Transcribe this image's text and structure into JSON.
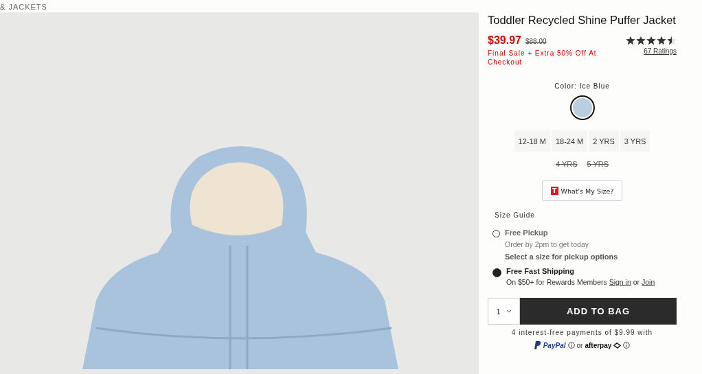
{
  "breadcrumb": "& JACKETS",
  "product": {
    "title": "Toddler Recycled Shine Puffer Jacket",
    "price": "$39.97",
    "original_price": "$88.00",
    "promo": "Final Sale + Extra 50% Off At Checkout",
    "stars": 4.5,
    "ratings": "67 Ratings"
  },
  "color": {
    "label": "Color: Ice Blue",
    "swatches": [
      {
        "color": "#b8cfdf",
        "selected": true
      }
    ]
  },
  "sizes": [
    {
      "label": "12-18 M",
      "available": true
    },
    {
      "label": "18-24 M",
      "available": true
    },
    {
      "label": "2 YRS",
      "available": true
    },
    {
      "label": "3 YRS",
      "available": true
    },
    {
      "label": "4 YRS",
      "available": false
    },
    {
      "label": "5 YRS",
      "available": false
    }
  ],
  "size_finder": {
    "badge": "T",
    "label": "What's My Size?"
  },
  "size_guide": "Size Guide",
  "fulfillment": [
    {
      "title": "Free Pickup",
      "selected": false,
      "lines": [
        "Order by 2pm to get today",
        "Select a size for pickup options"
      ]
    },
    {
      "title": "Free Fast Shipping",
      "selected": true,
      "text": "On $50+ for Rewards Members ",
      "sign_in": "Sign in",
      "or": " or ",
      "join": "Join"
    }
  ],
  "quantity": "1",
  "add_to_bag": "ADD TO BAG",
  "installments": "4 interest-free payments of $9.99 with",
  "pay_options": {
    "paypal": "PayPal",
    "or": "or",
    "afterpay": "afterpay"
  }
}
